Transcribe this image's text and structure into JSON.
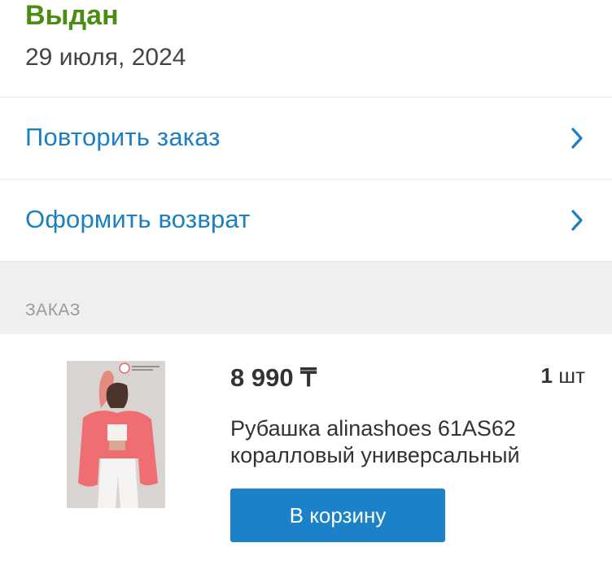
{
  "order": {
    "status": "Выдан",
    "date": "29 июля, 2024",
    "status_color": "#4d8c13"
  },
  "actions": [
    {
      "label": "Повторить заказ",
      "icon": "chevron-right-icon"
    },
    {
      "label": "Оформить возврат",
      "icon": "chevron-right-icon"
    }
  ],
  "section": {
    "title": "ЗАКАЗ"
  },
  "item": {
    "price": "8 990 ₸",
    "quantity_number": "1",
    "quantity_unit": "шт",
    "name": "Рубашка alinashoes 61AS62 коралловый универсальный",
    "cart_button": "В корзину",
    "accent_color": "#1b81c8"
  }
}
